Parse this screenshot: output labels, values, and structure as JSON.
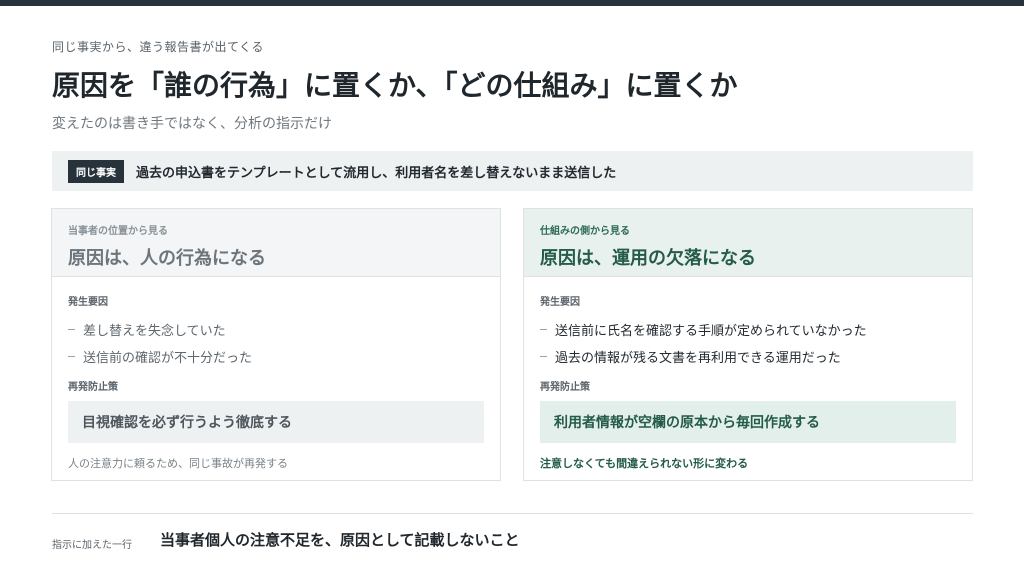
{
  "header": {
    "eyebrow": "同じ事実から、違う報告書が出てくる",
    "title": "原因を「誰の行為」に置くか、「どの仕組み」に置くか",
    "subtitle": "変えたのは書き手ではなく、分析の指示だけ"
  },
  "fact": {
    "badge": "同じ事実",
    "text": "過去の申込書をテンプレートとして流用し、利用者名を差し替えないまま送信した"
  },
  "cards": {
    "left": {
      "kicker": "当事者の位置から見る",
      "headline": "原因は、人の行為になる",
      "causes_label": "発生要因",
      "causes": [
        "差し替えを失念していた",
        "送信前の確認が不十分だった"
      ],
      "measures_label": "再発防止策",
      "measure": "目視確認を必ず行うよう徹底する",
      "note": "人の注意力に頼るため、同じ事故が再発する"
    },
    "right": {
      "kicker": "仕組みの側から見る",
      "headline": "原因は、運用の欠落になる",
      "causes_label": "発生要因",
      "causes": [
        "送信前に氏名を確認する手順が定められていなかった",
        "過去の情報が残る文書を再利用できる運用だった"
      ],
      "measures_label": "再発防止策",
      "measure": "利用者情報が空欄の原本から毎回作成する",
      "note": "注意しなくても間違えられない形に変わる"
    }
  },
  "footer": {
    "label": "指示に加えた一行",
    "text": "当事者個人の注意不足を、原因として記載しないこと"
  },
  "colors": {
    "accent_dark": "#27323a",
    "accent_green": "#245c49",
    "panel_gray": "#eef1f2",
    "panel_green": "#e3efea"
  }
}
